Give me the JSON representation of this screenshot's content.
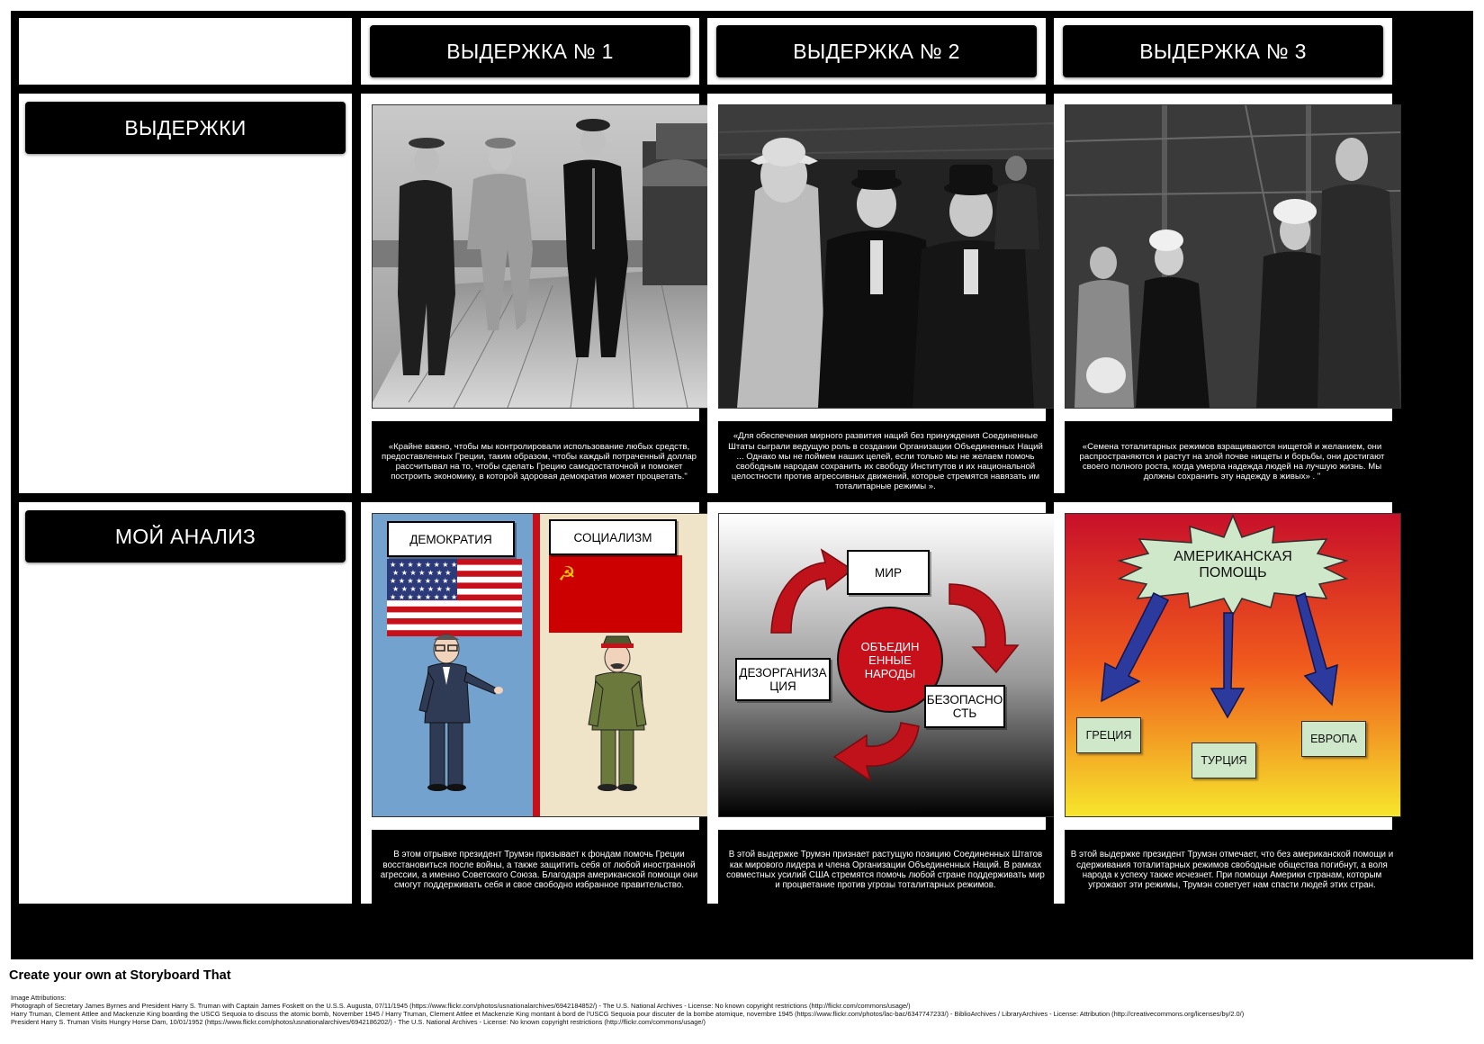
{
  "headers": {
    "col1": "ВЫДЕРЖКА № 1",
    "col2": "ВЫДЕРЖКА № 2",
    "col3": "ВЫДЕРЖКА № 3"
  },
  "rows": {
    "row1": "ВЫДЕРЖКИ",
    "row2": "МОЙ АНАЛИЗ"
  },
  "excerpts": [
    "«Крайне важно, чтобы мы контролировали использование любых средств, предоставленных Греции, таким образом, чтобы каждый потраченный доллар рассчитывал на то, чтобы сделать Грецию самодостаточной и поможет построить экономику, в которой здоровая демократия может процветать.\"",
    "«Для обеспечения мирного развития наций без принуждения Соединенные Штаты сыграли ведущую роль в создании Организации Объединенных Наций ... Однако мы не поймем наших целей, если только мы не желаем помочь свободным народам сохранить их свободу Институтов и их национальной целостности против агрессивных движений, которые стремятся навязать им тоталитарные режимы ».",
    "«Семена тоталитарных режимов взращиваются нищетой и желанием, они распространяются и растут на злой почве нищеты и борьбы, они достигают своего полного роста, когда умерла надежда людей на лучшую жизнь. Мы должны сохранить эту надежду в живых» . \""
  ],
  "analysis": [
    "В этом отрывке президент Трумэн призывает к фондам помочь Греции восстановиться после войны, а также защитить себя от любой иностранной агрессии, а именно Советского Союза. Благодаря американской помощи они смогут поддерживать себя и свое свободно избранное правительство.",
    "В этой выдержке Трумэн признает растущую позицию Соединенных Штатов как мирового лидера и члена Организации Объединенных Наций. В рамках совместных усилий США стремятся помочь любой стране поддерживать мир и процветание против угрозы тоталитарных режимов.",
    "В этой выдержке президент Трумэн отмечает, что без американской помощи и сдерживания тоталитарных режимов свободные общества погибнут, а воля народа к успеху также исчезнет. При помощи Америки странам, которым угрожают эти режимы, Трумэн советует нам спасти людей этих стран."
  ],
  "scene1": {
    "left_label": "ДЕМОКРАТИЯ",
    "right_label": "СОЦИАЛИЗМ"
  },
  "scene2": {
    "top": "МИР",
    "center": "ОБЪЕДИН ЕННЫЕ НАРОДЫ",
    "left": "ДЕЗОРГАНИЗА ЦИЯ",
    "right": "БЕЗОПАСНО СТЬ"
  },
  "scene3": {
    "burst": "АМЕРИКАНСКАЯ ПОМОЩЬ",
    "c1": "ГРЕЦИЯ",
    "c2": "ТУРЦИЯ",
    "c3": "ЕВРОПА"
  },
  "footer": {
    "cta": "Create your own at Storyboard That",
    "attrib_title": "Image Attributions:",
    "attrib1": "Photograph of Secretary James Byrnes and President Harry S. Truman with Captain James Foskett on the U.S.S. Augusta, 07/11/1945 (https://www.flickr.com/photos/usnationalarchives/6942184852/) - The U.S. National Archives - License: No known copyright restrictions (http://flickr.com/commons/usage/)",
    "attrib2": "Harry Truman, Clement Attlee and Mackenzie King boarding the USCG Sequoia to discuss the atomic bomb, November 1945 / Harry Truman, Clement Attlee et Mackenzie King montant à bord de l'USCG Sequoia pour discuter de la bombe atomique, novembre 1945 (https://www.flickr.com/photos/lac-bac/6347747233/) - BiblioArchives / LibraryArchives - License: Attribution (http://creativecommons.org/licenses/by/2.0/)",
    "attrib3": "President Harry S. Truman Visits Hungry Horse Dam, 10/01/1952 (https://www.flickr.com/photos/usnationalarchives/6942186202/) - The U.S. National Archives - License: No known copyright restrictions (http://flickr.com/commons/usage/)"
  },
  "colors": {
    "border": "#000000",
    "flag_blue": "#73a2cf",
    "flag_red": "#cc0000",
    "arrow_red": "#c0121a",
    "arrow_blue": "#2b3a9c"
  }
}
